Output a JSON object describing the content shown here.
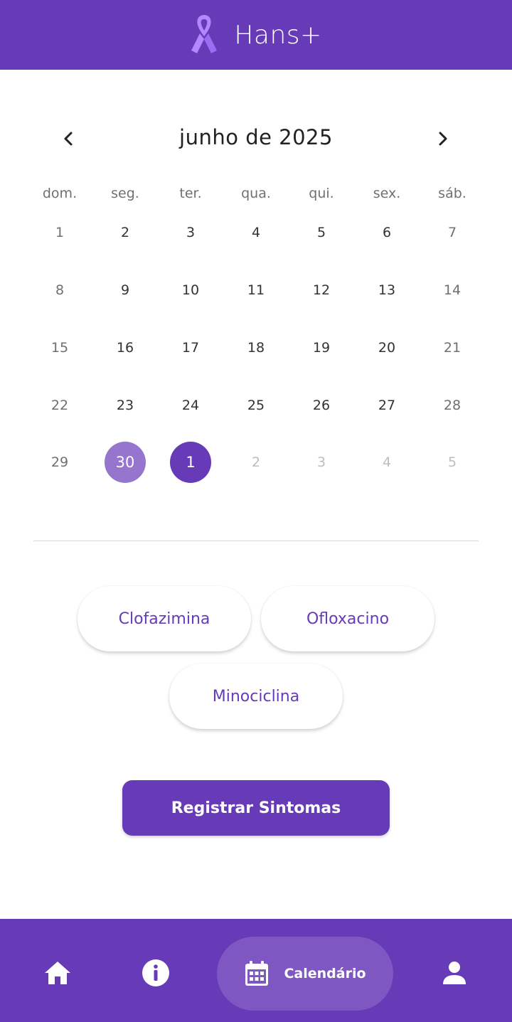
{
  "app": {
    "title": "Hans+"
  },
  "colors": {
    "primary": "#673ab7",
    "primary_light": "#9575cd",
    "nav_active": "#7e57c2",
    "ribbon": "#b388ff"
  },
  "icons": {
    "header": "awareness-ribbon-icon",
    "prev": "chevron-left-icon",
    "next": "chevron-right-icon",
    "home": "home-icon",
    "info": "info-icon",
    "calendar": "calendar-icon",
    "profile": "person-icon"
  },
  "calendar": {
    "month_label": "junho de 2025",
    "weekdays": [
      "dom.",
      "seg.",
      "ter.",
      "qua.",
      "qui.",
      "sex.",
      "sáb."
    ],
    "weeks": [
      [
        "1",
        "2",
        "3",
        "4",
        "5",
        "6",
        "7"
      ],
      [
        "8",
        "9",
        "10",
        "11",
        "12",
        "13",
        "14"
      ],
      [
        "15",
        "16",
        "17",
        "18",
        "19",
        "20",
        "21"
      ],
      [
        "22",
        "23",
        "24",
        "25",
        "26",
        "27",
        "28"
      ],
      [
        "29",
        "30",
        "1",
        "2",
        "3",
        "4",
        "5"
      ]
    ],
    "highlighted_days": [
      "30",
      "1"
    ]
  },
  "medications": [
    "Clofazimina",
    "Ofloxacino",
    "Minociclina"
  ],
  "actions": {
    "register_symptoms": "Registrar Sintomas"
  },
  "bottom_nav": {
    "active_label": "Calendário"
  }
}
